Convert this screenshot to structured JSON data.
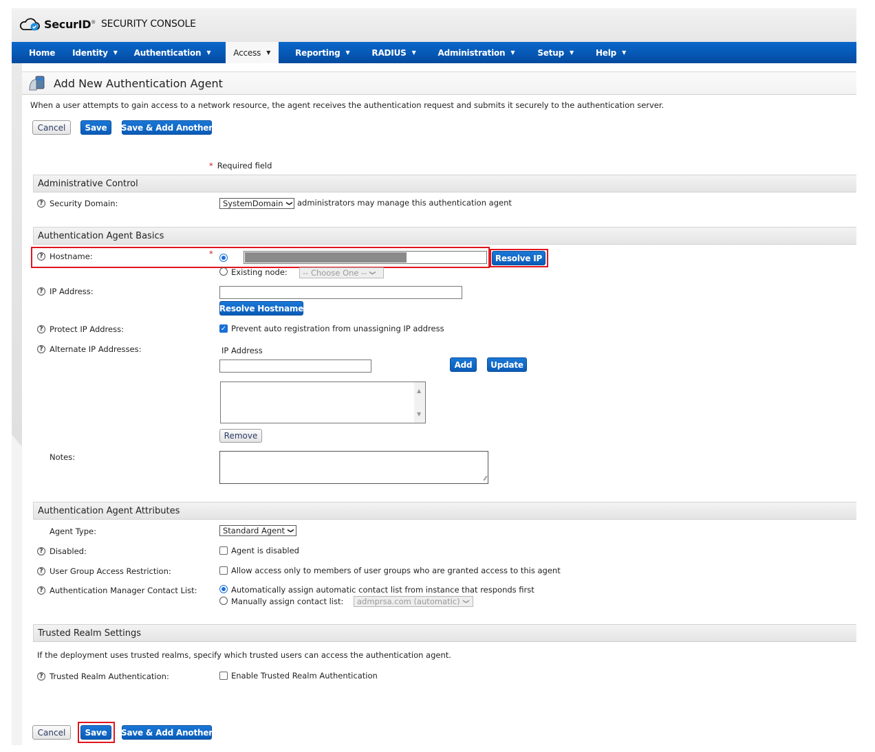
{
  "brand": {
    "name": "SecurID",
    "product": "SECURITY CONSOLE"
  },
  "nav": {
    "items": [
      {
        "label": "Home",
        "dropdown": false
      },
      {
        "label": "Identity",
        "dropdown": true
      },
      {
        "label": "Authentication",
        "dropdown": true
      },
      {
        "label": "Access",
        "dropdown": true,
        "active": true
      },
      {
        "label": "Reporting",
        "dropdown": true
      },
      {
        "label": "RADIUS",
        "dropdown": true
      },
      {
        "label": "Administration",
        "dropdown": true
      },
      {
        "label": "Setup",
        "dropdown": true
      },
      {
        "label": "Help",
        "dropdown": true
      }
    ],
    "caret": "▼",
    "active_color": "#f7f7f7",
    "bar_color": "#0658b5"
  },
  "page": {
    "title": "Add New Authentication Agent",
    "description": "When a user attempts to gain access to a network resource, the agent receives the authentication request and submits it securely to the authentication server.",
    "required_note": "Required field",
    "required_star": "*"
  },
  "actions": {
    "cancel": "Cancel",
    "save": "Save",
    "save_add": "Save & Add Another"
  },
  "sections": {
    "admin_control": {
      "title": "Administrative Control",
      "security_domain": {
        "label": "Security Domain:",
        "value": "SystemDomain",
        "suffix": "administrators may manage this authentication agent"
      }
    },
    "basics": {
      "title": "Authentication Agent Basics",
      "hostname": {
        "label": "Hostname:",
        "value": "",
        "value_redacted": true,
        "resolve_ip": "Resolve IP",
        "existing_node_label": "Existing node:",
        "existing_node_value": "-- Choose One --"
      },
      "ip_address": {
        "label": "IP Address:",
        "value": "",
        "resolve_hostname": "Resolve Hostname"
      },
      "protect_ip": {
        "label": "Protect IP Address:",
        "checkbox_label": "Prevent auto registration from unassigning IP address",
        "checked": true
      },
      "alternate_ips": {
        "label": "Alternate IP Addresses:",
        "column_header": "IP Address",
        "value": "",
        "add": "Add",
        "update": "Update",
        "remove": "Remove",
        "items": []
      },
      "notes": {
        "label": "Notes:",
        "value": ""
      }
    },
    "attributes": {
      "title": "Authentication Agent Attributes",
      "agent_type": {
        "label": "Agent Type:",
        "value": "Standard Agent"
      },
      "disabled": {
        "label": "Disabled:",
        "checkbox_label": "Agent is disabled",
        "checked": false
      },
      "user_group": {
        "label": "User Group Access Restriction:",
        "checkbox_label": "Allow access only to members of user groups who are granted access to this agent",
        "checked": false
      },
      "contact_list": {
        "label": "Authentication Manager Contact List:",
        "auto_label": "Automatically assign automatic contact list from instance that responds first",
        "manual_label": "Manually assign contact list:",
        "manual_value": "admprsa.com (automatic)",
        "selected": "auto"
      }
    },
    "trusted_realm": {
      "title": "Trusted Realm Settings",
      "description": "If the deployment uses trusted realms, specify which trusted users can access the authentication agent.",
      "auth": {
        "label": "Trusted Realm Authentication:",
        "checkbox_label": "Enable Trusted Realm Authentication",
        "checked": false
      }
    }
  },
  "icons": {
    "help": "?",
    "chevron_down": "❯",
    "check": "✓",
    "scroll_up": "▲",
    "scroll_down": "▼",
    "resize_grip": "⁄⁄"
  },
  "colors": {
    "primary_button": "#0a5cb8",
    "highlight": "#e0141e",
    "required": "#c4161c"
  }
}
